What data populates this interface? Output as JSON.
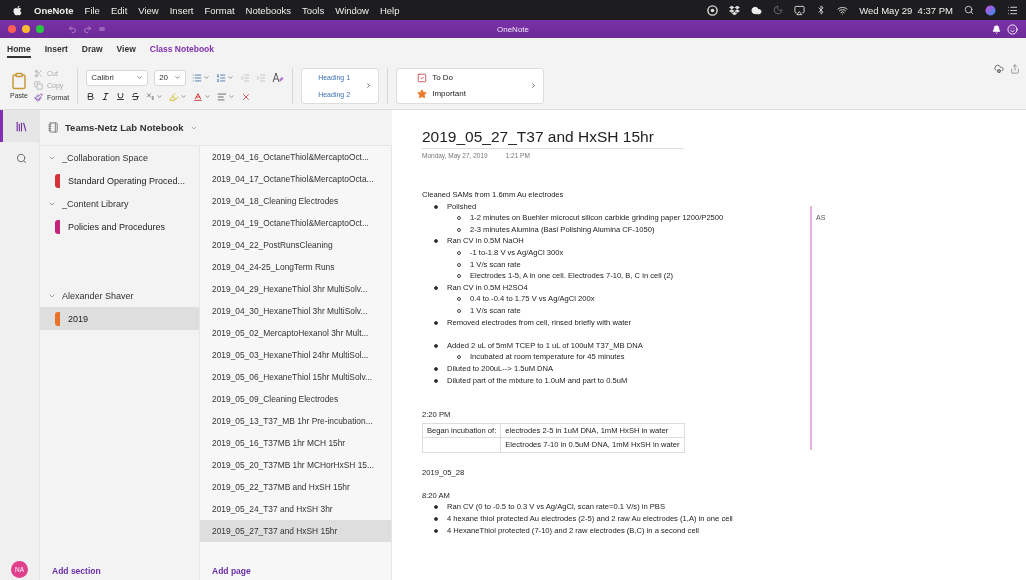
{
  "menu_bar": {
    "app": "OneNote",
    "items": [
      "File",
      "Edit",
      "View",
      "Insert",
      "Format",
      "Notebooks",
      "Tools",
      "Window",
      "Help"
    ],
    "clock": "Wed May 29  4:37 PM"
  },
  "title_bar": {
    "title": "OneNote"
  },
  "ribbon_tabs": [
    {
      "label": "Home",
      "selected": true,
      "kind": "plain"
    },
    {
      "label": "Insert",
      "selected": false,
      "kind": "plain"
    },
    {
      "label": "Draw",
      "selected": false,
      "kind": "plain"
    },
    {
      "label": "View",
      "selected": false,
      "kind": "plain"
    },
    {
      "label": "Class Notebook",
      "selected": false,
      "kind": "accent"
    }
  ],
  "ribbon": {
    "paste": "Paste",
    "clipboard": [
      {
        "label": "Cut",
        "kind": "cut",
        "disabled": true
      },
      {
        "label": "Copy",
        "kind": "copy",
        "disabled": true
      },
      {
        "label": "Format",
        "kind": "format",
        "disabled": false
      }
    ],
    "font": {
      "name": "Calibri",
      "size": "20"
    },
    "styles": [
      "Heading 1",
      "Heading 2"
    ],
    "tags": [
      {
        "label": "To Do",
        "kind": "todo"
      },
      {
        "label": "Important",
        "kind": "important"
      }
    ]
  },
  "notebook": {
    "name": "Teams-Netz Lab Notebook",
    "section_groups": [
      {
        "name": "_Collaboration Space",
        "expanded": true,
        "sections": [
          {
            "name": "Standard Operating Proced...",
            "color": "#d6323a",
            "selected": false
          }
        ]
      },
      {
        "name": "_Content Library",
        "expanded": true,
        "sections": [
          {
            "name": "Policies and Procedures",
            "color": "#c4247a",
            "selected": false
          }
        ]
      },
      {
        "name": "Alexander Shaver",
        "expanded": true,
        "sections": [
          {
            "name": "2019",
            "color": "#e8722a",
            "selected": true
          }
        ]
      }
    ]
  },
  "pages": [
    {
      "title": "2019_04_16_OctaneThiol&MercaptoOct...",
      "selected": false
    },
    {
      "title": "2019_04_17_OctaneThiol&MercaptoOcta...",
      "selected": false
    },
    {
      "title": "2019_04_18_Cleaning Electrodes",
      "selected": false
    },
    {
      "title": "2019_04_19_OctaneThiol&MercaptoOct...",
      "selected": false
    },
    {
      "title": "2019_04_22_PostRunsCleaning",
      "selected": false
    },
    {
      "title": "2019_04_24-25_LongTerm Runs",
      "selected": false
    },
    {
      "title": "2019_04_29_HexaneThiol 3hr MultiSolv...",
      "selected": false
    },
    {
      "title": "2019_04_30_HexaneThiol 3hr MultiSolv...",
      "selected": false
    },
    {
      "title": "2019_05_02_MercaptoHexanol 3hr Mult...",
      "selected": false
    },
    {
      "title": "2019_05_03_HexaneThiol 24hr MultiSol...",
      "selected": false
    },
    {
      "title": "2019_05_06_HexaneThiol 15hr MultiSolv...",
      "selected": false
    },
    {
      "title": "2019_05_09_Cleaning Electrodes",
      "selected": false
    },
    {
      "title": "2019_05_13_T37_MB 1hr Pre-incubation...",
      "selected": false
    },
    {
      "title": "2019_05_16_T37MB 1hr MCH 15hr",
      "selected": false
    },
    {
      "title": "2019_05_20_T37MB 1hr MCHorHxSH 15...",
      "selected": false
    },
    {
      "title": "2019_05_22_T37MB and HxSH 15hr",
      "selected": false
    },
    {
      "title": "2019_05_24_T37 and HxSH 3hr",
      "selected": false
    },
    {
      "title": "2019_05_27_T37 and HxSH 15hr",
      "selected": true
    }
  ],
  "footer": {
    "add_section": "Add section",
    "add_page": "Add page"
  },
  "user": {
    "initials": "NA"
  },
  "note": {
    "title": "2019_05_27_T37 and HxSH 15hr",
    "date": "Monday, May 27, 2019",
    "time": "1:21 PM",
    "author": "AS",
    "body": [
      {
        "kind": "line",
        "text": "Cleaned SAMs from 1.6mm Au electrodes"
      },
      {
        "kind": "bullets",
        "items": [
          {
            "text": "Polished",
            "children": [
              {
                "text": "1-2 minutes on Buehler microcut silicon carbide grinding paper 1200/P2500"
              },
              {
                "text": "2-3 minutes Alumina (Basi Polishing Alumina CF-1050)"
              }
            ]
          },
          {
            "text": "Ran CV in 0.5M NaOH",
            "children": [
              {
                "text": "-1 to-1.8 V vs Ag/AgCl 300x"
              },
              {
                "text": "1 V/s scan rate"
              },
              {
                "text": "Electrodes 1-5, A in one cell. Electrodes 7-10, B, C in cell (2)"
              }
            ]
          },
          {
            "text": "Ran CV in 0.5M H2SO4",
            "children": [
              {
                "text": "0.4 to -0.4 to 1.75 V vs Ag/AgCl 200x"
              },
              {
                "text": "1 V/s scan rate"
              }
            ]
          },
          {
            "text": "Removed electrodes from cell, rinsed briefly with water"
          }
        ]
      },
      {
        "kind": "blank"
      },
      {
        "kind": "bullets",
        "items": [
          {
            "text": "Added 2 uL of 5mM TCEP to 1 uL of 100uM T37_MB DNA",
            "children": [
              {
                "text": "Incubated at room temperature for 45 minutes"
              }
            ]
          },
          {
            "text": "Diluted to 200uL--> 1.5uM DNA"
          },
          {
            "text": "Diluted part of the mixture to 1.0uM and part to 0.5uM"
          }
        ]
      },
      {
        "kind": "blank"
      },
      {
        "kind": "blank"
      },
      {
        "kind": "line",
        "text": "2:20 PM"
      },
      {
        "kind": "table",
        "rows": [
          {
            "label": "Began incubation of:",
            "value": "electrodes 2-5 in 1uM DNA, 1mM HxSH in water"
          },
          {
            "value": "Electrodes 7-10 in 0.5uM DNA, 1mM HxSH in water"
          }
        ]
      },
      {
        "kind": "blank"
      },
      {
        "kind": "line",
        "text": "2019_05_28"
      },
      {
        "kind": "blank"
      },
      {
        "kind": "line",
        "text": "8:20 AM"
      },
      {
        "kind": "bullets",
        "items": [
          {
            "text": "Ran CV (0 to -0.5 to 0.3 V vs Ag/AgCl, scan rate=0.1 V/s) in PBS"
          },
          {
            "text": "4 hexane thiol protected Au electrodes (2-5) and 2 raw Au electrodes (1,A) in one cell"
          },
          {
            "text": "4 HexaneThiol protected (7-10) and 2 raw electrodes (B,C) in a second cell"
          }
        ]
      }
    ]
  }
}
